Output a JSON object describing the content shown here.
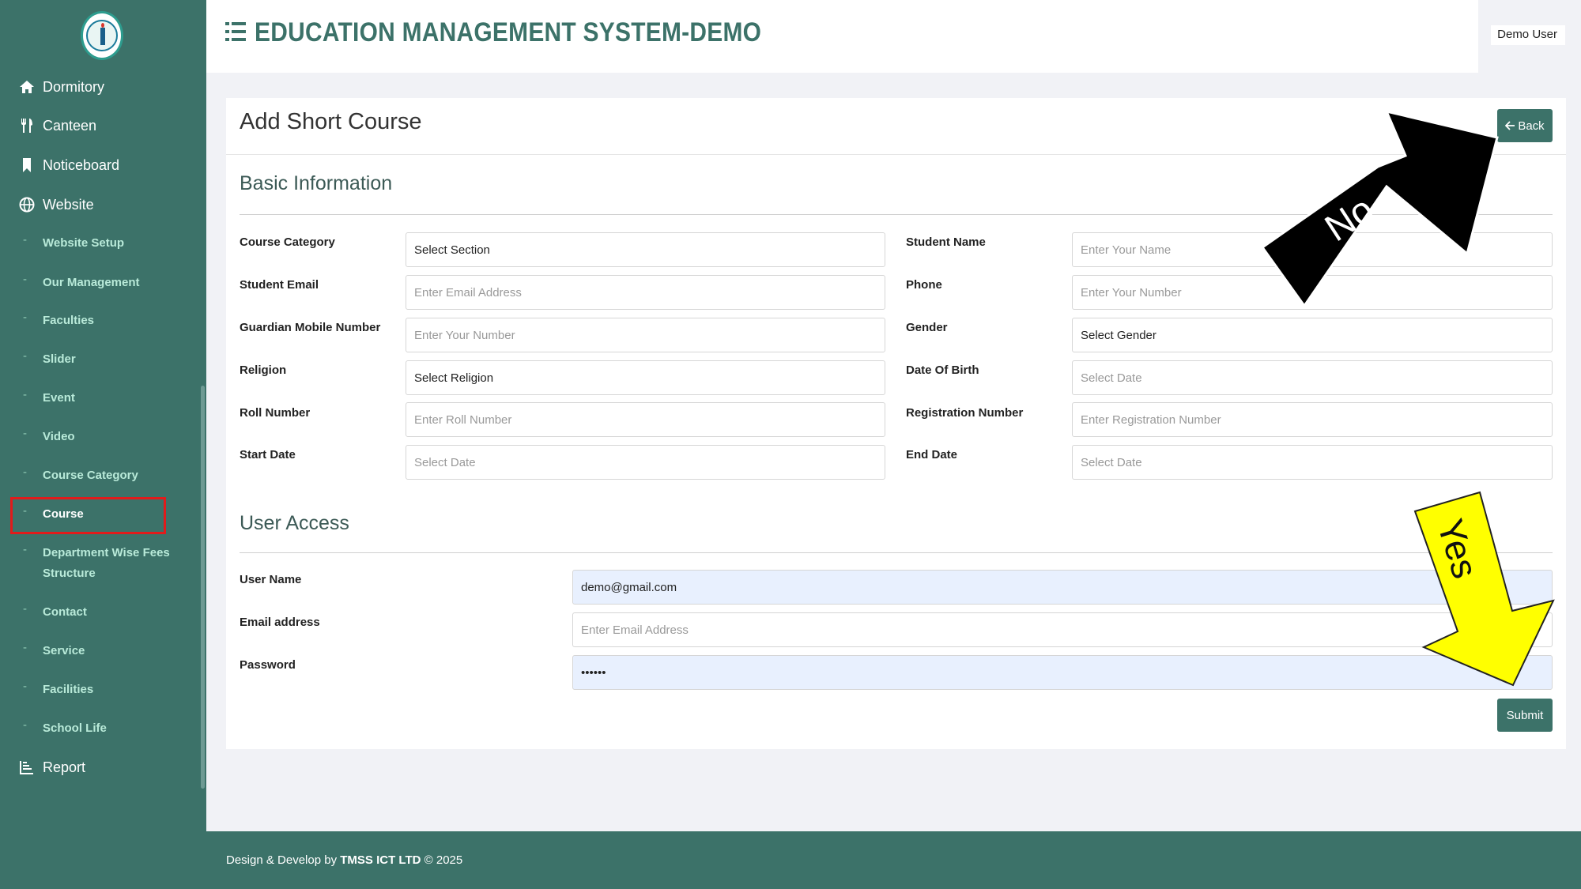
{
  "sidebar": {
    "nav_top": [
      {
        "label": "Dormitory",
        "icon": "home-icon"
      },
      {
        "label": "Canteen",
        "icon": "utensils-icon"
      },
      {
        "label": "Noticeboard",
        "icon": "bookmark-icon"
      },
      {
        "label": "Website",
        "icon": "globe-icon"
      }
    ],
    "sub_items": [
      {
        "label": "Website Setup"
      },
      {
        "label": "Our Management"
      },
      {
        "label": "Faculties"
      },
      {
        "label": "Slider"
      },
      {
        "label": "Event"
      },
      {
        "label": "Video"
      },
      {
        "label": "Course Category"
      },
      {
        "label": "Course"
      },
      {
        "label": "Department Wise Fees Structure"
      },
      {
        "label": "Contact"
      },
      {
        "label": "Service"
      },
      {
        "label": "Facilities"
      },
      {
        "label": "School Life"
      }
    ],
    "nav_bottom": [
      {
        "label": "Report",
        "icon": "chart-icon"
      }
    ],
    "active_item": "Course"
  },
  "header": {
    "title": "EDUCATION MANAGEMENT SYSTEM-DEMO",
    "user": "Demo User"
  },
  "card": {
    "title": "Add Short Course",
    "back_label": "Back"
  },
  "basic": {
    "title": "Basic Information",
    "fields": [
      {
        "label": "Course Category",
        "value": "Select Section",
        "kind": "select"
      },
      {
        "label": "Student Name",
        "value": "Enter Your Name",
        "kind": "placeholder"
      },
      {
        "label": "Student Email",
        "value": "Enter Email Address",
        "kind": "placeholder"
      },
      {
        "label": "Phone",
        "value": "Enter Your Number",
        "kind": "placeholder"
      },
      {
        "label": "Guardian Mobile Number",
        "value": "Enter Your Number",
        "kind": "placeholder"
      },
      {
        "label": "Gender",
        "value": "Select Gender",
        "kind": "select"
      },
      {
        "label": "Religion",
        "value": "Select Religion",
        "kind": "select"
      },
      {
        "label": "Date Of Birth",
        "value": "Select Date",
        "kind": "placeholder"
      },
      {
        "label": "Roll Number",
        "value": "Enter Roll Number",
        "kind": "placeholder"
      },
      {
        "label": "Registration Number",
        "value": "Enter Registration Number",
        "kind": "placeholder"
      },
      {
        "label": "Start Date",
        "value": "Select Date",
        "kind": "placeholder"
      },
      {
        "label": "End Date",
        "value": "Select Date",
        "kind": "placeholder"
      }
    ]
  },
  "access": {
    "title": "User Access",
    "fields": [
      {
        "label": "User Name",
        "value": "demo@gmail.com",
        "kind": "filled"
      },
      {
        "label": "Email address",
        "value": "Enter Email Address",
        "kind": "placeholder"
      },
      {
        "label": "Password",
        "value": "••••••",
        "kind": "filled"
      }
    ]
  },
  "submit_label": "Submit",
  "annotations": {
    "no_label": "No",
    "yes_label": "Yes",
    "no_color": "#000000",
    "yes_color": "#ffff00",
    "highlight_color": "#e11b1b"
  },
  "footer": {
    "prefix": "Design & Develop by",
    "company": "TMSS ICT LTD",
    "suffix": "© 2025"
  },
  "colors": {
    "brand": "#3c7269",
    "sub_text": "#b9ead9"
  }
}
